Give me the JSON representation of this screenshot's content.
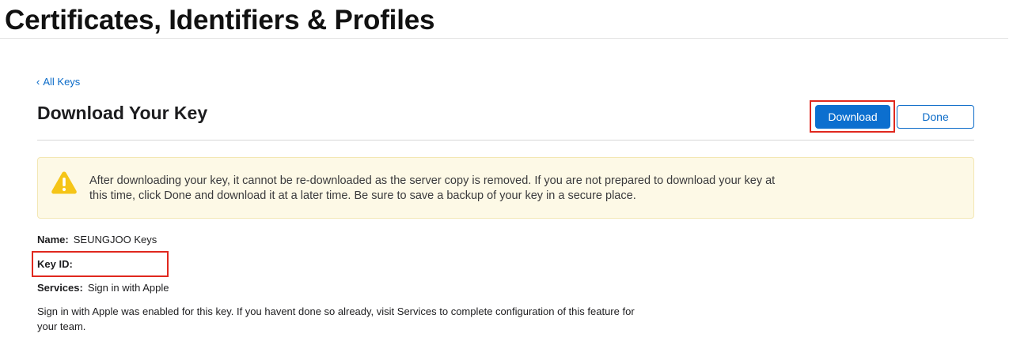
{
  "header": {
    "title": "Certificates, Identifiers & Profiles"
  },
  "nav": {
    "back_chevron": "‹",
    "back_label": "All Keys"
  },
  "section": {
    "title": "Download Your Key"
  },
  "actions": {
    "download_label": "Download",
    "done_label": "Done",
    "primary_color": "#0c6fcf",
    "highlight_color": "#e0281e"
  },
  "notice": {
    "icon": "warning-triangle-icon",
    "icon_color": "#f5c518",
    "text": "After downloading your key, it cannot be re-downloaded as the server copy is removed. If you are not prepared to download your key at this time, click Done and download it at a later time. Be sure to save a backup of your key in a secure place."
  },
  "details": {
    "name_label": "Name:",
    "name_value": "SEUNGJOO Keys",
    "key_id_label": "Key ID:",
    "key_id_value": "",
    "services_label": "Services:",
    "services_value": "Sign in with Apple",
    "services_note": "Sign in with Apple was enabled for this key. If you havent done so already, visit Services to complete configuration of this feature for your team."
  }
}
